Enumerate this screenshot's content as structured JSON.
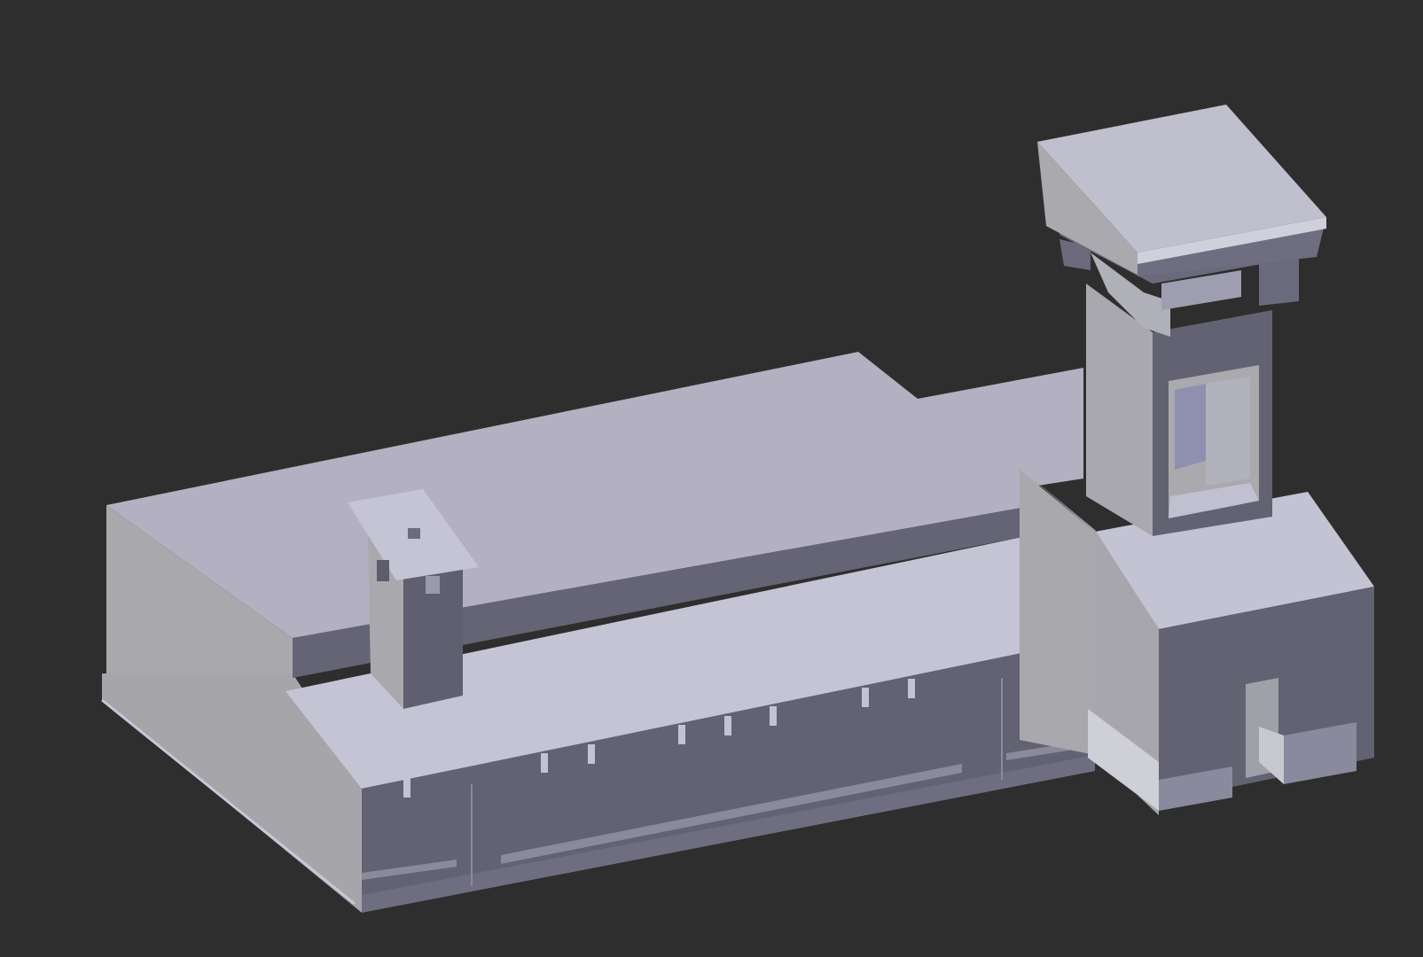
{
  "scene": {
    "background": "#2e2e2e",
    "model": "building-with-bell-tower",
    "shading": {
      "roof_light": "#c3c3d3",
      "roof_mid": "#b3b1c1",
      "wall_light": "#a9a9ad",
      "wall_dark": "#646474",
      "edge_highlight": "#d4d4dc",
      "trim_shadow": "#8a8a9a"
    }
  }
}
